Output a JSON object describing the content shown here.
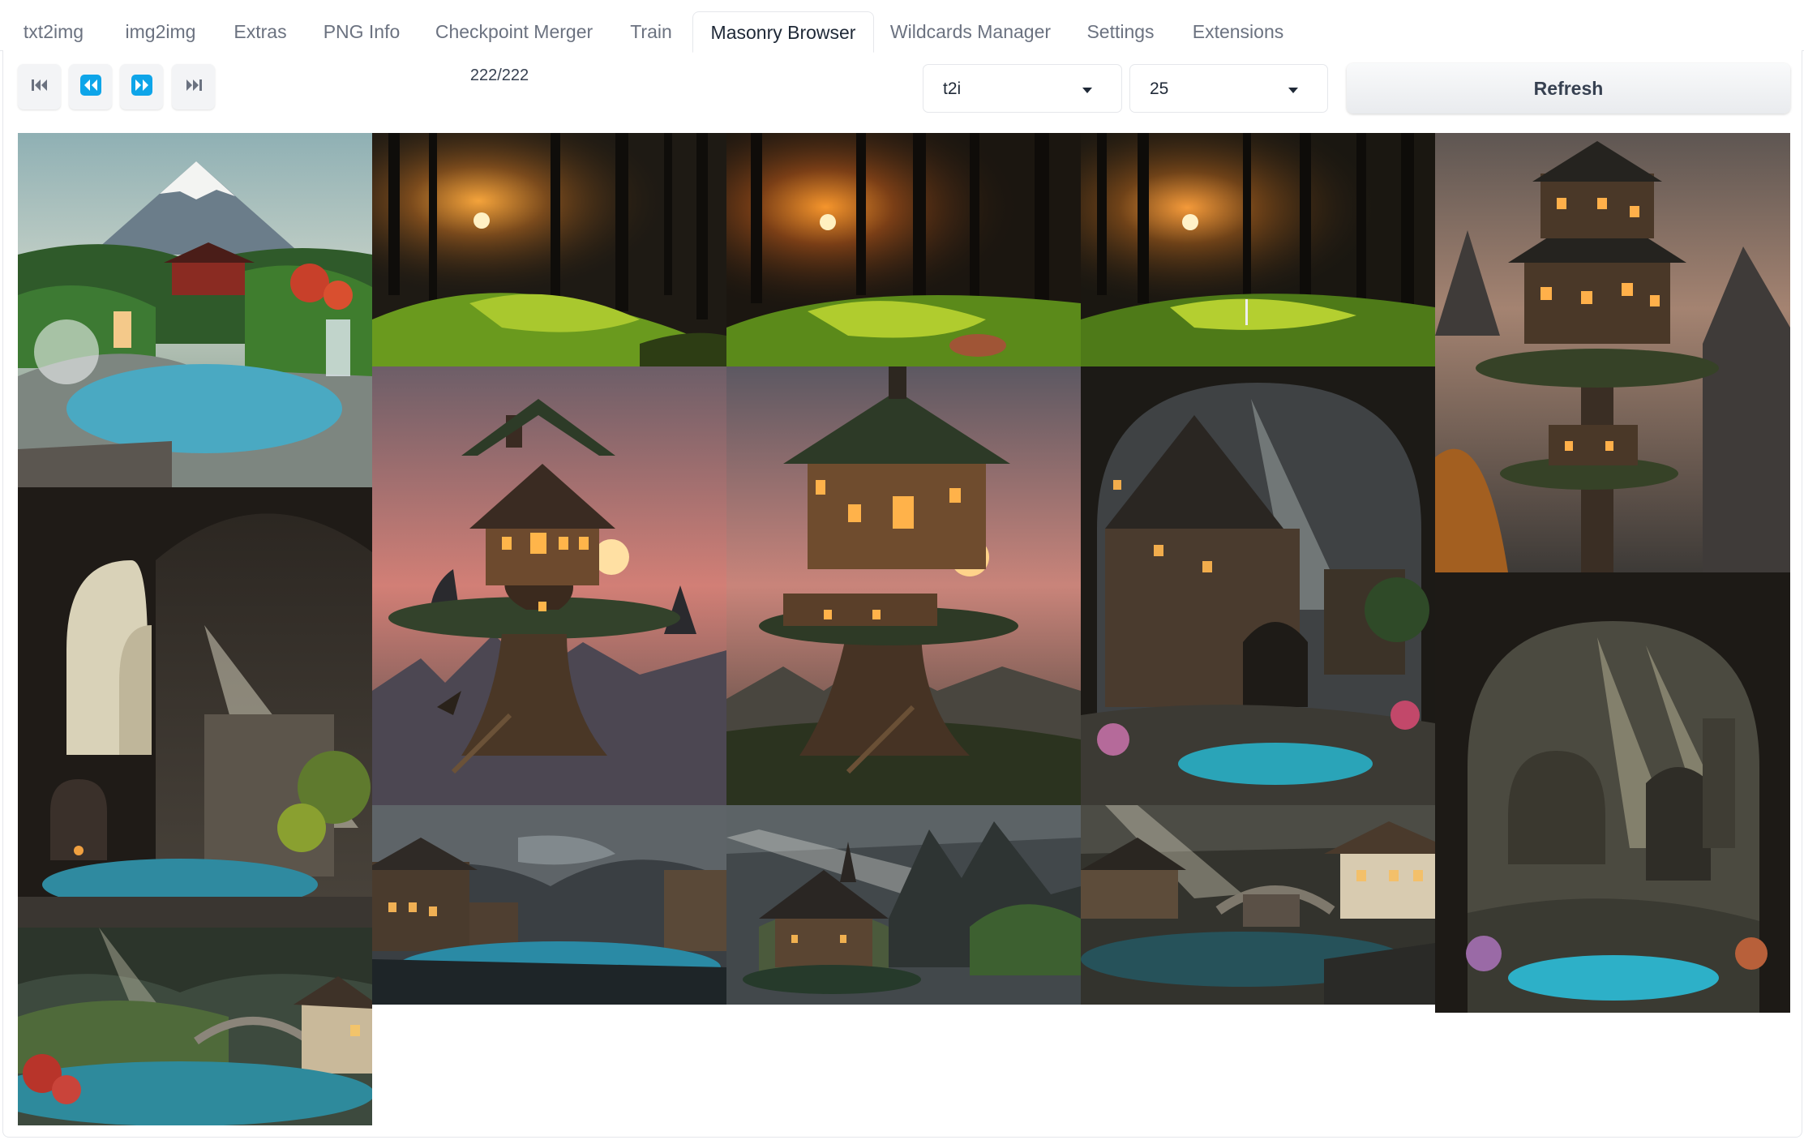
{
  "tabs": [
    {
      "label": "txt2img"
    },
    {
      "label": "img2img"
    },
    {
      "label": "Extras"
    },
    {
      "label": "PNG Info"
    },
    {
      "label": "Checkpoint Merger"
    },
    {
      "label": "Train"
    },
    {
      "label": "Masonry Browser"
    },
    {
      "label": "Wildcards Manager"
    },
    {
      "label": "Settings"
    },
    {
      "label": "Extensions"
    }
  ],
  "active_tab": "Masonry Browser",
  "toolbar": {
    "buttons": [
      {
        "icon": "skip-first-icon"
      },
      {
        "icon": "rewind-icon"
      },
      {
        "icon": "fast-forward-icon"
      },
      {
        "icon": "skip-last-icon"
      }
    ],
    "count_label": "222/222",
    "source_select": "t2i",
    "page_size_select": "25",
    "refresh_label": "Refresh"
  },
  "colors": {
    "accent_button": "#0ea5e9",
    "button_bg": "#f3f4f6",
    "border": "#e5e7eb"
  },
  "images": [
    {
      "subject": "mount-fuji-hot-spring"
    },
    {
      "subject": "interior-hall-pool"
    },
    {
      "subject": "valley-river-bridge"
    },
    {
      "subject": "forest-sunset-golf-course"
    },
    {
      "subject": "tree-house-sunset"
    },
    {
      "subject": "village-river-mist"
    },
    {
      "subject": "forest-sunset-golf-green"
    },
    {
      "subject": "tree-house-dusk"
    },
    {
      "subject": "church-lake-light-rays"
    },
    {
      "subject": "forest-golf-flag"
    },
    {
      "subject": "arched-village-stream"
    },
    {
      "subject": "river-village-light-rays"
    },
    {
      "subject": "tower-tree-house-mountains"
    },
    {
      "subject": "cave-arch-spring"
    }
  ]
}
